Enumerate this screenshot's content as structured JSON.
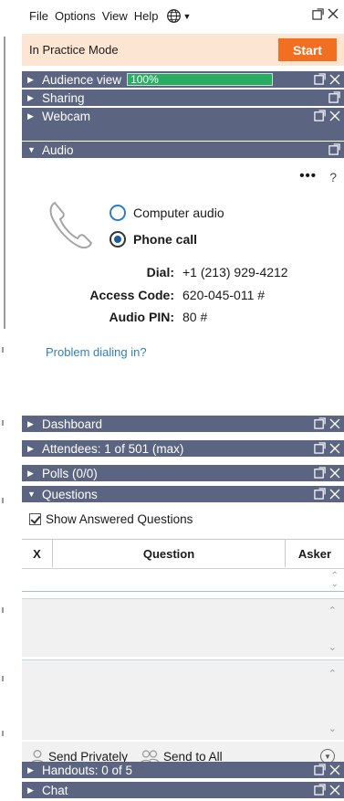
{
  "menu": {
    "file": "File",
    "options": "Options",
    "view": "View",
    "help": "Help"
  },
  "practice": {
    "label": "In Practice Mode",
    "start_label": "Start"
  },
  "sections": {
    "audience_view": "Audience view",
    "audience_progress_text": "100%",
    "audience_progress_fraction": 1.0,
    "sharing": "Sharing",
    "webcam": "Webcam",
    "audio": "Audio",
    "dashboard": "Dashboard",
    "attendees": "Attendees:  1 of 501 (max)",
    "polls": "Polls (0/0)",
    "questions": "Questions",
    "handouts": "Handouts: 0 of 5",
    "chat": "Chat"
  },
  "audio": {
    "more_label": "•••",
    "help_label": "?",
    "computer_audio_label": "Computer audio",
    "phone_call_label": "Phone call",
    "dial_label": "Dial:",
    "dial_value": "+1 (213) 929-4212",
    "access_code_label": "Access Code:",
    "access_code_value": "620-045-011 #",
    "pin_label": "Audio PIN:",
    "pin_value": "80 #",
    "problem_link": "Problem dialing in?"
  },
  "questions": {
    "show_answered_label": "Show Answered Questions",
    "columns": [
      "X",
      "Question",
      "Asker"
    ],
    "send_privately_label": "Send Privately",
    "send_to_all_label": "Send to All"
  },
  "colors": {
    "header_bar": "#5b6581",
    "start_button": "#f26f21",
    "practice_bg": "#fce6d3",
    "progress_fill": "#27ae60",
    "link": "#2f7fc1"
  }
}
